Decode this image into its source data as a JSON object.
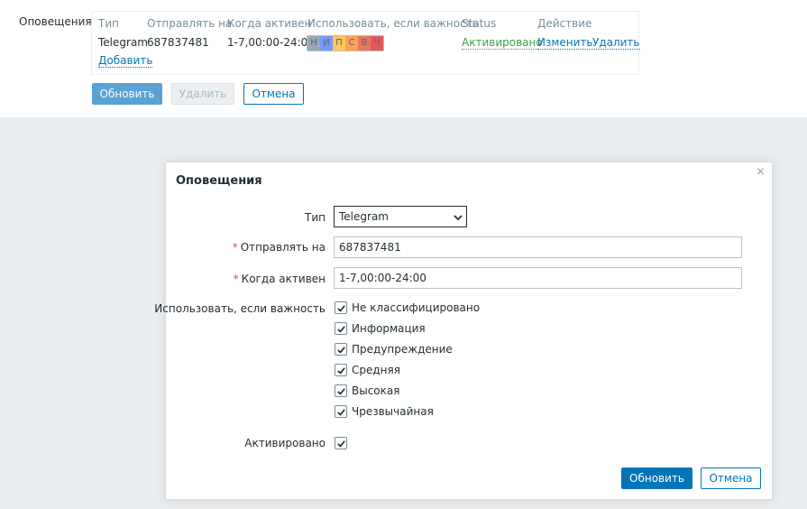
{
  "section_label": "Оповещения",
  "table": {
    "headers": [
      "Тип",
      "Отправлять на",
      "Когда активен",
      "Использовать, если важность",
      "Status",
      "Действие"
    ],
    "row": {
      "type": "Telegram",
      "send_to": "687837481",
      "when_active": "1-7,00:00-24:00",
      "severities": [
        {
          "label": "Н",
          "color": "#97aab3"
        },
        {
          "label": "И",
          "color": "#7499ff"
        },
        {
          "label": "П",
          "color": "#ffc859"
        },
        {
          "label": "С",
          "color": "#ffa059"
        },
        {
          "label": "В",
          "color": "#e97659"
        },
        {
          "label": "Ч",
          "color": "#e45959"
        }
      ],
      "status": "Активировано",
      "edit": "Изменить",
      "remove": "Удалить"
    },
    "add": "Добавить"
  },
  "form_buttons": {
    "update": "Обновить",
    "delete": "Удалить",
    "cancel": "Отмена"
  },
  "dialog": {
    "title": "Оповещения",
    "close": "×",
    "type_label": "Тип",
    "type_value": "Telegram",
    "send_to_label": "Отправлять на",
    "send_to_value": "687837481",
    "when_label": "Когда активен",
    "when_value": "1-7,00:00-24:00",
    "severity_label": "Использовать, если важность",
    "severity_options": [
      {
        "label": "Не классифицировано",
        "checked": true
      },
      {
        "label": "Информация",
        "checked": true
      },
      {
        "label": "Предупреждение",
        "checked": true
      },
      {
        "label": "Средняя",
        "checked": true
      },
      {
        "label": "Высокая",
        "checked": true
      },
      {
        "label": "Чрезвычайная",
        "checked": true
      }
    ],
    "enabled_label": "Активировано",
    "enabled_checked": true,
    "update": "Обновить",
    "cancel": "Отмена"
  }
}
